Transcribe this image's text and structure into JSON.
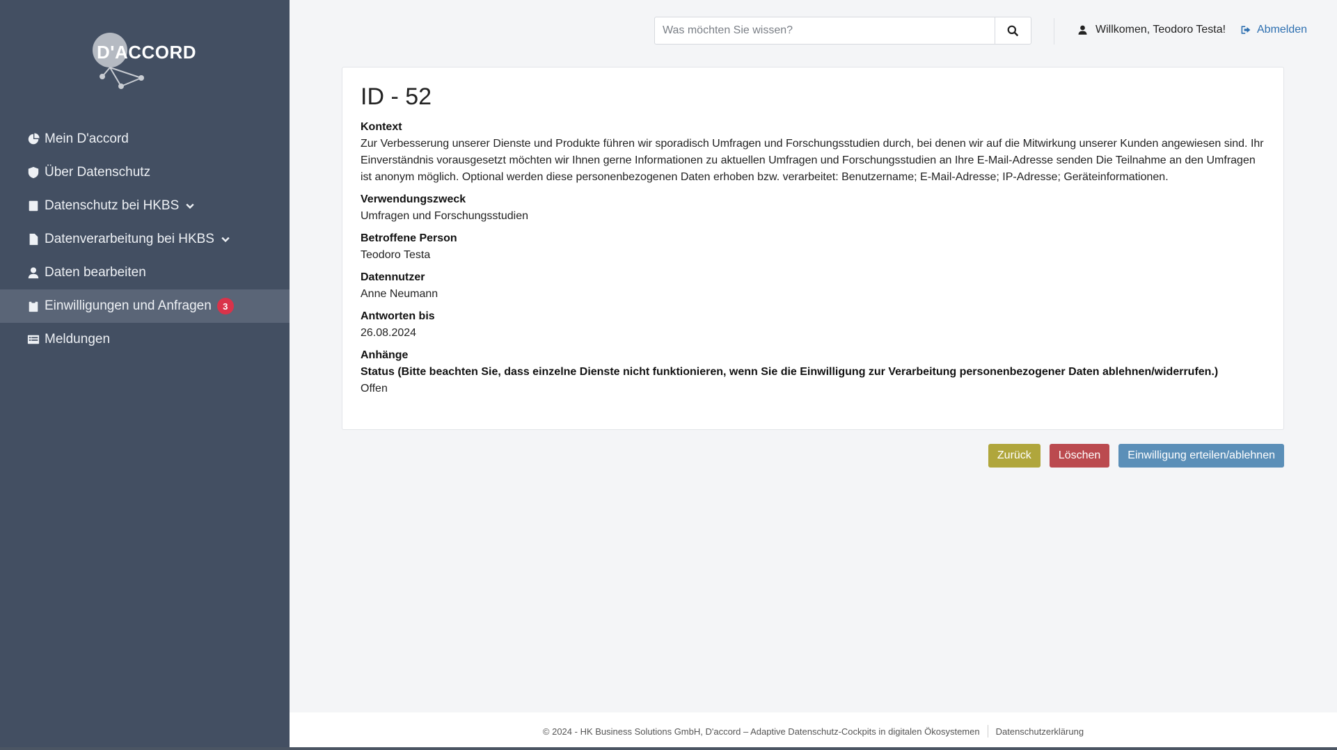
{
  "brand": {
    "logo_text": "D'ACCORD"
  },
  "sidebar": {
    "items": [
      {
        "label": "Mein D'accord",
        "icon": "pie-chart-icon"
      },
      {
        "label": "Über Datenschutz",
        "icon": "shield-icon"
      },
      {
        "label": "Datenschutz bei HKBS",
        "icon": "book-icon",
        "expandable": true
      },
      {
        "label": "Datenverarbeitung bei HKBS",
        "icon": "file-icon",
        "expandable": true
      },
      {
        "label": "Daten bearbeiten",
        "icon": "user-icon"
      },
      {
        "label": "Einwilligungen und Anfragen",
        "icon": "clipboard-icon",
        "badge": "3",
        "active": true
      },
      {
        "label": "Meldungen",
        "icon": "list-icon"
      }
    ]
  },
  "header": {
    "search_placeholder": "Was möchten Sie wissen?",
    "welcome": "Willkomen, Teodoro Testa!",
    "logout": "Abmelden"
  },
  "detail": {
    "title": "ID - 52",
    "context_label": "Kontext",
    "context_text": "Zur Verbesserung unserer Dienste und Produkte führen wir sporadisch Umfragen und Forschungsstudien durch, bei denen wir auf die Mitwirkung unserer Kunden angewiesen sind. Ihr Einverständnis vorausgesetzt möchten wir Ihnen gerne Informationen zu aktuellen Umfragen und Forschungsstudien an Ihre E-Mail-Adresse senden Die Teilnahme an den Umfragen ist anonym möglich. Optional werden diese personenbezogenen Daten erhoben bzw. verarbeitet: Benutzername; E-Mail-Adresse; IP-Adresse; Geräteinformationen.",
    "purpose_label": "Verwendungszweck",
    "purpose_value": "Umfragen und Forschungsstudien",
    "person_label": "Betroffene Person",
    "person_value": "Teodoro Testa",
    "user_label": "Datennutzer",
    "user_value": "Anne Neumann",
    "deadline_label": "Antworten bis",
    "deadline_value": "26.08.2024",
    "attachments_label": "Anhänge",
    "status_label": "Status (Bitte beachten Sie, dass einzelne Dienste nicht funktionieren, wenn Sie die Einwilligung zur Verarbeitung personenbezogener Daten ablehnen/widerrufen.)",
    "status_value": "Offen"
  },
  "actions": {
    "back": "Zurück",
    "delete": "Löschen",
    "consent": "Einwilligung erteilen/ablehnen"
  },
  "footer": {
    "copyright": "© 2024 - HK Business Solutions GmbH, D'accord – Adaptive Datenschutz-Cockpits in digitalen Ökosystemen",
    "privacy": "Datenschutzerklärung"
  },
  "colors": {
    "sidebar": "#434f62",
    "sidebar_active": "#5a6577",
    "badge": "#d9334a",
    "back": "#b0a63c",
    "delete": "#bb4a4f",
    "consent": "#5b8fb8",
    "link": "#2d6fb0"
  }
}
